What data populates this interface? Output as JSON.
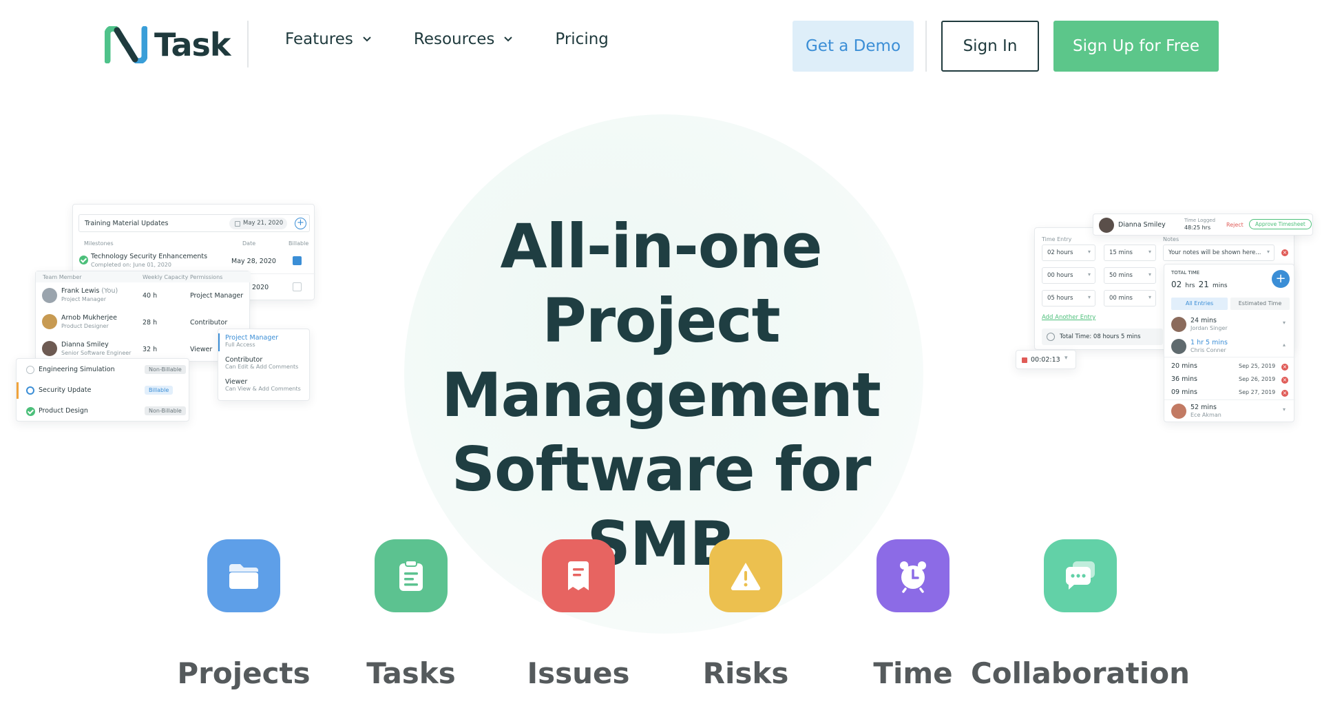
{
  "header": {
    "logo_text": "Task",
    "nav": [
      {
        "label": "Features",
        "has_dropdown": true
      },
      {
        "label": "Resources",
        "has_dropdown": true
      },
      {
        "label": "Pricing",
        "has_dropdown": false
      }
    ],
    "demo_label": "Get a Demo",
    "signin_label": "Sign In",
    "signup_label": "Sign Up for Free"
  },
  "hero": {
    "line1": "All-in-one Project",
    "line2": "Management",
    "line3": "Software for SMB"
  },
  "left_panel": {
    "task_input_value": "Training Material Updates",
    "task_date": "May 21, 2020",
    "milestones_header": "Milestones",
    "date_header": "Date",
    "billable_header": "Billable",
    "milestone1_title": "Technology Security Enhancements",
    "milestone1_sub": "Completed on: June 01, 2020",
    "milestone1_date": "May 28, 2020",
    "milestone2_date": "2020",
    "team_header": "Team Member",
    "capacity_header": "Weekly Capacity",
    "permissions_header": "Permissions",
    "members": [
      {
        "name": "Frank Lewis",
        "you": "(You)",
        "role": "Project Manager",
        "hours": "40 h",
        "permission": "Project Manager"
      },
      {
        "name": "Arnob Mukherjee",
        "role": "Product Designer",
        "hours": "28 h",
        "permission": "Contributor"
      },
      {
        "name": "Dianna Smiley",
        "role": "Senior Software Engineer",
        "hours": "32 h",
        "permission": "Viewer"
      }
    ],
    "perm_options": [
      {
        "title": "Project Manager",
        "sub": "Full Access"
      },
      {
        "title": "Contributor",
        "sub": "Can Edit & Add Comments"
      },
      {
        "title": "Viewer",
        "sub": "Can View & Add Comments"
      }
    ],
    "projects": [
      {
        "name": "Engineering Simulation",
        "tag": "Non-Billable"
      },
      {
        "name": "Security Update",
        "tag": "Billable"
      },
      {
        "name": "Product Design",
        "tag": "Non-Billable"
      }
    ]
  },
  "right_panel": {
    "user_name": "Dianna Smiley",
    "time_logged_label": "Time Logged",
    "time_logged_value": "48:25 hrs",
    "reject_label": "Reject",
    "approve_label": "Approve Timesheet",
    "time_entry_label": "Time Entry",
    "notes_label": "Notes",
    "notes_placeholder": "Your notes will be shown here...",
    "entries": [
      {
        "hours": "02 hours",
        "mins": "15 mins"
      },
      {
        "hours": "00 hours",
        "mins": "50 mins"
      },
      {
        "hours": "05 hours",
        "mins": "00 mins"
      }
    ],
    "add_entry": "Add Another Entry",
    "total_time_line": "Total Time: 08 hours 5 mins",
    "timer": "00:02:13",
    "total_time_label": "TOTAL TIME",
    "total_hrs": "02",
    "hrs_unit": "hrs",
    "total_mins": "21",
    "mins_unit": "mins",
    "tab_all": "All Entries",
    "tab_est": "Estimated Time",
    "log1_time": "24 mins",
    "log1_name": "Jordan Singer",
    "log2_time": "1 hr 5 mins",
    "log2_name": "Chris Conner",
    "sub_logs": [
      {
        "time": "20 mins",
        "date": "Sep 25, 2019"
      },
      {
        "time": "36 mins",
        "date": "Sep 26, 2019"
      },
      {
        "time": "09 mins",
        "date": "Sep 27, 2019"
      }
    ],
    "log3_time": "52 mins",
    "log3_name": "Ece Akman"
  },
  "features": [
    {
      "label": "Projects",
      "icon": "folder-icon",
      "color": "#5e9fe8"
    },
    {
      "label": "Tasks",
      "icon": "clipboard-icon",
      "color": "#5cc290"
    },
    {
      "label": "Issues",
      "icon": "ticket-icon",
      "color": "#e76461"
    },
    {
      "label": "Risks",
      "icon": "warning-icon",
      "color": "#ecc04f"
    },
    {
      "label": "Time",
      "icon": "alarm-clock-icon",
      "color": "#8c6be6"
    },
    {
      "label": "Collaboration",
      "icon": "chat-bubbles-icon",
      "color": "#62d1a7"
    }
  ],
  "colors": {
    "brand_green": "#5cc68a",
    "demo_bg": "#deeef9",
    "demo_text": "#3b8ed6",
    "heading": "#1f3e42"
  }
}
